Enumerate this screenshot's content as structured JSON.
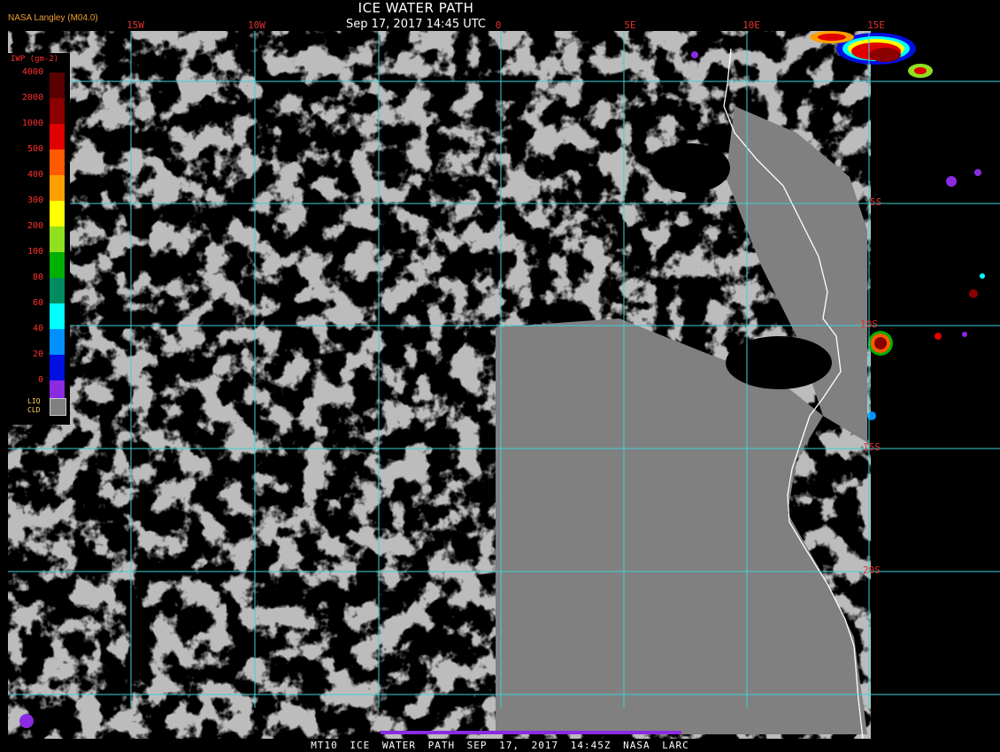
{
  "header": {
    "title": "ICE WATER PATH",
    "subtitle": "Sep 17, 2017 14:45 UTC",
    "source": "NASA Langley (M04.0)"
  },
  "footer": {
    "caption": "MT10  ICE WATER PATH  SEP 17, 2017 14:45Z  NASA LARC"
  },
  "grid": {
    "longitude_labels": [
      "15W",
      "10W",
      "0",
      "5E",
      "10E",
      "15E"
    ],
    "latitude_labels": [
      "5S",
      "10S",
      "15S",
      "20S"
    ],
    "line_color": "#3fd0d8",
    "label_color": "#e03030"
  },
  "legend": {
    "title": "IWP (gm-2)",
    "bins": [
      {
        "label": "4000",
        "color": "#5a0000"
      },
      {
        "label": "2000",
        "color": "#8b0000"
      },
      {
        "label": "1000",
        "color": "#e00000"
      },
      {
        "label": "500",
        "color": "#ff5a00"
      },
      {
        "label": "400",
        "color": "#ffa000"
      },
      {
        "label": "300",
        "color": "#ffff00"
      },
      {
        "label": "200",
        "color": "#90e020"
      },
      {
        "label": "100",
        "color": "#00b000"
      },
      {
        "label": "80",
        "color": "#008c60"
      },
      {
        "label": "60",
        "color": "#00ffff"
      },
      {
        "label": "40",
        "color": "#0090ff"
      },
      {
        "label": "20",
        "color": "#0010e0"
      },
      {
        "label": "0",
        "color": "#8a2be2"
      }
    ],
    "liquid_cloud_label_1": "LIQ",
    "liquid_cloud_label_2": "CLD",
    "liquid_cloud_color": "#808080"
  },
  "colors": {
    "cloud": "#808080",
    "clear": "#000000",
    "coastline": "#ffffff"
  }
}
